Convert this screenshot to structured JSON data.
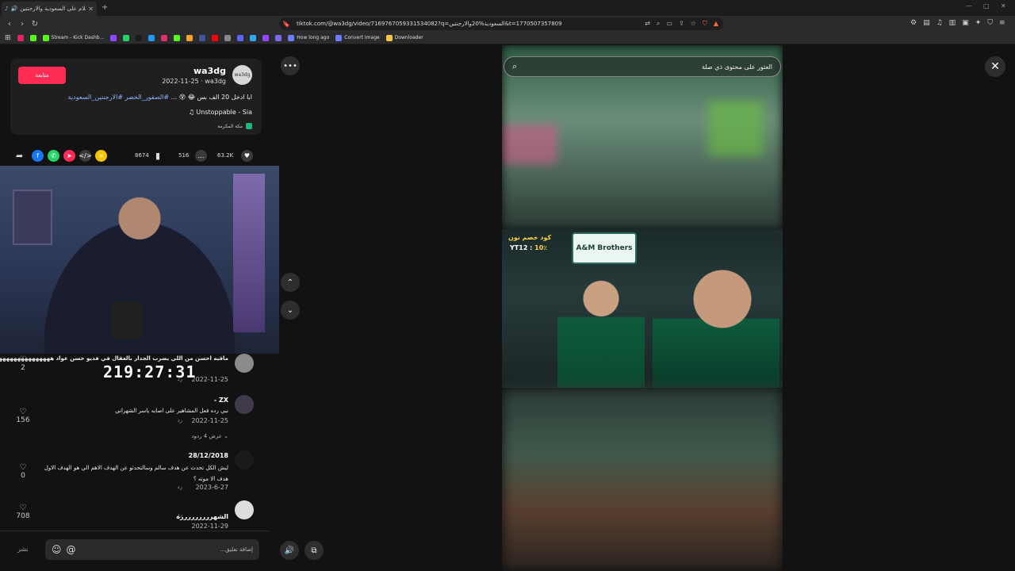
{
  "browser": {
    "tab_title": "اعلام على السعودية والارجنتين",
    "tab_icons": [
      "tiktok-icon",
      "speaker-icon"
    ],
    "url": "tiktok.com/@wa3dg/video/7169767059331534082?q=السعودية%20والارجنتين&t=1770507357809",
    "bookmarks": [
      {
        "label": "",
        "color": "#e0245e"
      },
      {
        "label": "",
        "color": "#53fc18"
      },
      {
        "label": "Stream - Kick Dashb...",
        "color": "#53fc18"
      },
      {
        "label": "",
        "color": "#9146ff"
      },
      {
        "label": "",
        "color": "#25d366"
      },
      {
        "label": "",
        "color": "#1a1a1a"
      },
      {
        "label": "",
        "color": "#1d9bf0"
      },
      {
        "label": "",
        "color": "#e1306c"
      },
      {
        "label": "",
        "color": "#53fc18"
      },
      {
        "label": "",
        "color": "#f5a623"
      },
      {
        "label": "",
        "color": "#3b5998"
      },
      {
        "label": "",
        "color": "#ff0000"
      },
      {
        "label": "",
        "color": "#888888"
      },
      {
        "label": "",
        "color": "#5865f2"
      },
      {
        "label": "",
        "color": "#2aabee"
      },
      {
        "label": "",
        "color": "#9146ff"
      },
      {
        "label": "",
        "color": "#7b68ee"
      },
      {
        "label": "How long ago",
        "color": "#6b7cff"
      },
      {
        "label": "Convert Image",
        "color": "#6b7cff"
      },
      {
        "label": "Downloader",
        "color": "#f5c542"
      }
    ]
  },
  "post": {
    "follow_label": "متابعة",
    "username": "wa3dg",
    "date_user": "2022-11-25 · wa3dg",
    "caption_text": "ابا ادخل 20 الف بس 😂 😵 ...",
    "caption_tags": "#الصقور_الخضر #الارجنتين_السعودية",
    "music": "♫  Unstoppable - Sia",
    "location": "مكة المكرمة"
  },
  "actions": {
    "likes": "63.2K",
    "comments": "516",
    "saves": "8674"
  },
  "comments": [
    {
      "text": "ماقيه احسن من اللي يضرب الجدار بالعقال في فديو حسن عواد ههههههههههههههههههههههههههههههههههههههههههههه",
      "date": "2022-11-25",
      "reply": "رد",
      "likes": "2"
    },
    {
      "name": "ZX -",
      "text": "نبي رده فعل المشاهير على اصابه ياسر الشهراني",
      "date": "2022-11-25",
      "reply": "رد",
      "likes": "156",
      "view_replies": "عرض 4 ردود ⌄"
    },
    {
      "name": "28/12/2018",
      "text": "ليش الكل تحدث عن هدف سالم وسالتحدثو عن الهدف الاهم الي هو الهدف الاول هدف الا موته ؟",
      "date": "2023-6-27",
      "reply": "رد",
      "likes": "0"
    },
    {
      "name": "الشهررررررررره",
      "text": "",
      "date": "2022-11-29",
      "reply": "رد",
      "likes": "708"
    }
  ],
  "timer_overlay": "219:27:31",
  "comment_bar": {
    "post_label": "نشر",
    "placeholder": "إضافة تعليق..."
  },
  "player": {
    "search_text": "العثور على محتوى ذي صلة",
    "sign_text": "A&M Brothers",
    "promo_line1": "كود خصم نون",
    "promo_code": "YT12",
    "promo_pct": "10٪"
  }
}
